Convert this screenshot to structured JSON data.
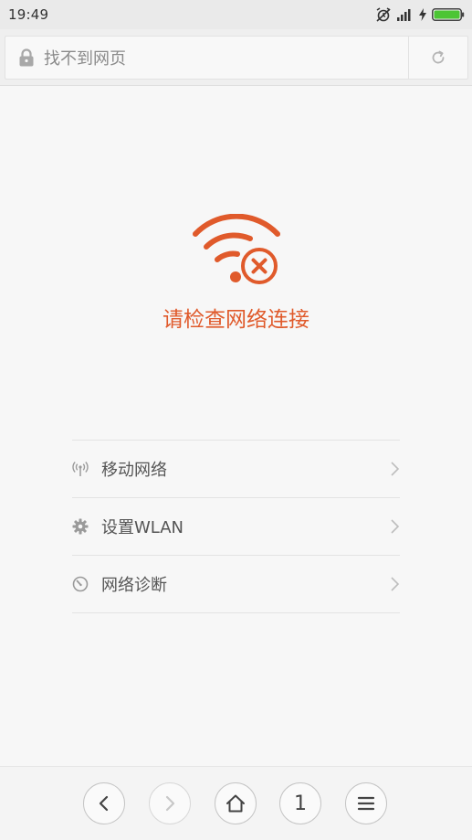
{
  "status_bar": {
    "time": "19:49",
    "icons": [
      "alarm-off-icon",
      "signal-icon",
      "charging-icon",
      "battery-icon"
    ],
    "battery_color": "#4cc534"
  },
  "address_bar": {
    "text": "找不到网页",
    "icon": "lock-icon",
    "reload_icon": "reload-icon"
  },
  "error": {
    "icon": "wifi-error-icon",
    "message": "请检查网络连接",
    "accent_color": "#e05a2b"
  },
  "options": [
    {
      "label": "移动网络",
      "icon": "antenna-icon"
    },
    {
      "label": "设置WLAN",
      "icon": "gear-icon"
    },
    {
      "label": "网络诊断",
      "icon": "diagnose-icon"
    }
  ],
  "toolbar": {
    "back_icon": "back-icon",
    "forward_icon": "forward-icon",
    "home_icon": "home-icon",
    "tab_count": "1",
    "menu_icon": "menu-icon"
  }
}
